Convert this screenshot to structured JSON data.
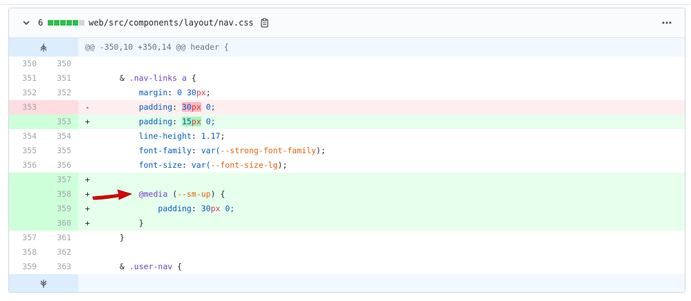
{
  "file": {
    "change_count": "6",
    "path": "web/src/components/layout/nav.css",
    "diffstat": [
      "add",
      "add",
      "add",
      "add",
      "add",
      "neutral"
    ]
  },
  "hunk_top": "@@ -350,10 +350,14 @@ header {",
  "lines": [
    {
      "type": "ctx",
      "old": "350",
      "new": "350"
    },
    {
      "type": "ctx",
      "old": "351",
      "new": "351"
    },
    {
      "type": "ctx",
      "old": "352",
      "new": "352"
    },
    {
      "type": "del",
      "old": "353",
      "new": "",
      "marker": "-"
    },
    {
      "type": "add",
      "old": "",
      "new": "353",
      "marker": "+"
    },
    {
      "type": "ctx",
      "old": "354",
      "new": "354"
    },
    {
      "type": "ctx",
      "old": "355",
      "new": "355"
    },
    {
      "type": "ctx",
      "old": "356",
      "new": "356"
    },
    {
      "type": "add",
      "old": "",
      "new": "357",
      "marker": "+"
    },
    {
      "type": "add",
      "old": "",
      "new": "358",
      "marker": "+"
    },
    {
      "type": "add",
      "old": "",
      "new": "359",
      "marker": "+"
    },
    {
      "type": "add",
      "old": "",
      "new": "360",
      "marker": "+"
    },
    {
      "type": "ctx",
      "old": "357",
      "new": "361"
    },
    {
      "type": "ctx",
      "old": "358",
      "new": "362"
    },
    {
      "type": "ctx",
      "old": "359",
      "new": "363"
    }
  ],
  "code": {
    "l351_amp": "&",
    "l351_sel": ".nav-links a",
    "l351_brace": "{",
    "l352_prop": "margin",
    "l352_val_a": "0",
    "l352_val_b": "30",
    "l352_unit": "px",
    "l353del_prop": "padding",
    "l353del_num": "30",
    "l353del_unit": "px",
    "l353del_rest": "0;",
    "l353add_prop": "padding",
    "l353add_num": "15",
    "l353add_unit": "px",
    "l353add_rest": "0;",
    "l354_prop": "line-height",
    "l354_val": "1.17",
    "l355_prop": "font-family",
    "l355_fn": "var(",
    "l355_var": "--strong-font-family",
    "l355_end": ");",
    "l356_prop": "font-size",
    "l356_fn": "var(",
    "l356_var": "--font-size-lg",
    "l356_end": ");",
    "l358_at": "@media",
    "l358_open": "(",
    "l358_var": "--sm-up",
    "l358_close": ") {",
    "l359_prop": "padding",
    "l359_num": "30",
    "l359_unit": "px",
    "l359_rest": "0;",
    "l360_brace": "}",
    "l361_brace": "}",
    "l363_amp": "&",
    "l363_sel": ".user-nav",
    "l363_brace": "{"
  },
  "colors": {
    "add_bg": "#e6ffed",
    "del_bg": "#ffeef0",
    "hunk_bg": "#f1f8ff",
    "arrow": "#e00000"
  },
  "icons": [
    "chevron-down-icon",
    "copy-icon",
    "kebab-icon",
    "expand-up-icon",
    "expand-down-icon",
    "arrow-annotation"
  ]
}
